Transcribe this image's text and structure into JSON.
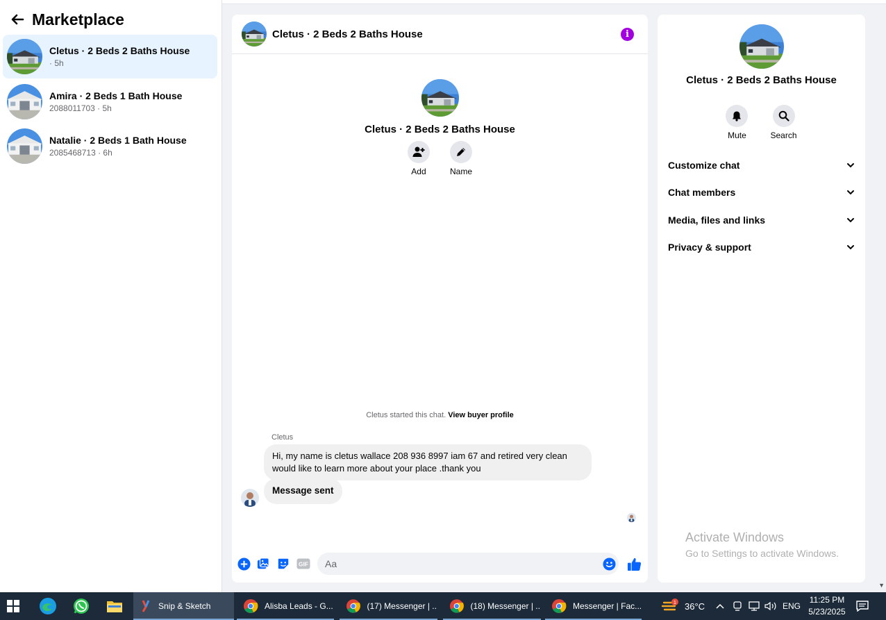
{
  "sidebar": {
    "title": "Marketplace",
    "conversations": [
      {
        "name": "Cletus · 2 Beds 2 Baths House",
        "sub": "· 5h"
      },
      {
        "name": "Amira · 2 Beds 1 Bath House",
        "sub": "2088011703 · 5h"
      },
      {
        "name": "Natalie · 2 Beds 1 Bath House",
        "sub": "2085468713 · 6h"
      }
    ]
  },
  "chat": {
    "title": "Cletus · 2 Beds 2 Baths House",
    "profile_title": "Cletus · 2 Beds 2 Baths House",
    "actions": {
      "add": "Add",
      "name": "Name"
    },
    "started_text": "Cletus started this chat.",
    "view_profile": "View buyer profile",
    "sender": "Cletus",
    "message": "Hi, my name is cletus wallace 208 936 8997 iam 67 and retired very clean would like to learn more about your place .thank you",
    "sent_message": "Message sent",
    "input_placeholder": "Aa",
    "gif_label": "GIF"
  },
  "details": {
    "title": "Cletus · 2 Beds 2 Baths House",
    "mute": "Mute",
    "search": "Search",
    "sections": [
      "Customize chat",
      "Chat members",
      "Media, files and links",
      "Privacy & support"
    ]
  },
  "watermark": {
    "line1": "Activate Windows",
    "line2": "Go to Settings to activate Windows."
  },
  "taskbar": {
    "apps": [
      "Snip & Sketch",
      "Alisba Leads - G...",
      "(17) Messenger | ...",
      "(18) Messenger | ...",
      "Messenger | Fac..."
    ],
    "weather": "36°C",
    "weather_badge": "1",
    "lang": "ENG",
    "time": "11:25 PM",
    "date": "5/23/2025"
  },
  "colors": {
    "accent": "#0866ff",
    "info": "#a300e0",
    "active_conversation": "#e7f3ff",
    "taskbar": "#1c2a3a"
  }
}
